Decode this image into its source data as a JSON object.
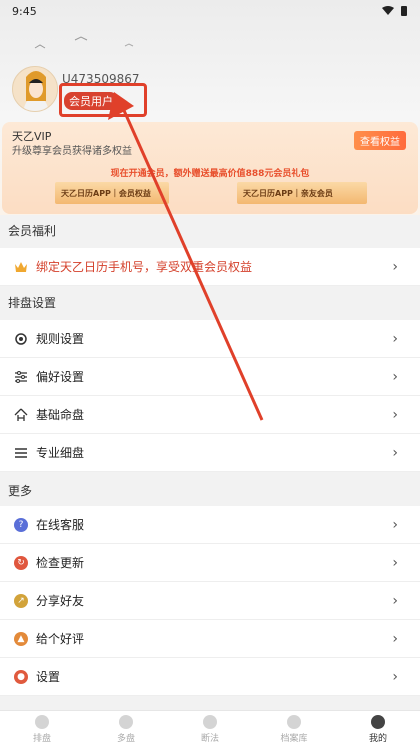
{
  "status": {
    "time": "9:45"
  },
  "profile": {
    "user_id": "U473509867",
    "badge": "会员用户"
  },
  "vip": {
    "title": "天乙VIP",
    "subtitle": "升级尊享会员获得诸多权益",
    "button": "查看权益",
    "promo": "现在开通会员，额外赠送最高价值888元会员礼包",
    "plan1": "天乙日历APP｜会员权益",
    "plan2": "天乙日历APP｜亲友会员"
  },
  "sections": {
    "benefits": "会员福利",
    "chart_settings": "排盘设置",
    "more": "更多"
  },
  "benefit_row": "绑定天乙日历手机号，享受双重会员权益",
  "chart_rows": [
    "规则设置",
    "偏好设置",
    "基础命盘",
    "专业细盘"
  ],
  "more_rows": [
    "在线客服",
    "检查更新",
    "分享好友",
    "给个好评",
    "设置"
  ],
  "nav": [
    "排盘",
    "多盘",
    "断法",
    "档案库",
    "我的"
  ],
  "colors": {
    "accent": "#d8422f",
    "vip_bg": "#fce1c8",
    "promo": "#e8502d"
  }
}
